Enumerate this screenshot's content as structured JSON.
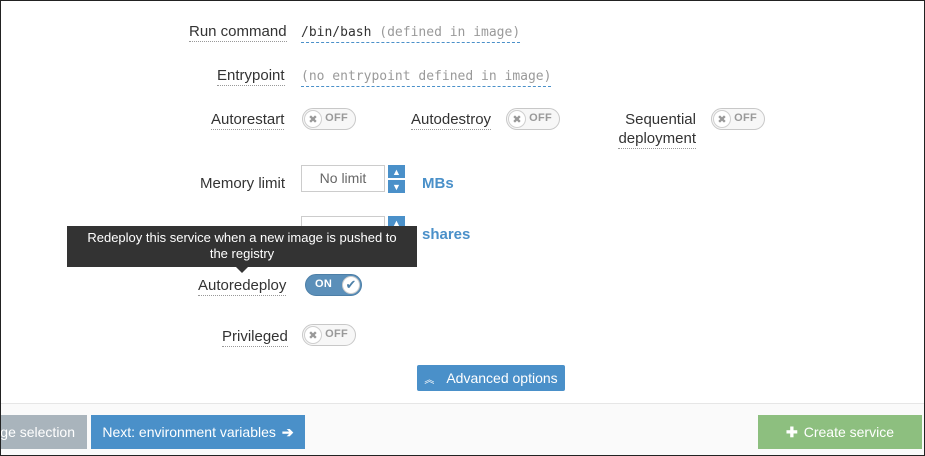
{
  "form": {
    "run_command": {
      "label": "Run command",
      "value": "/bin/bash",
      "hint": "(defined in image)"
    },
    "entrypoint": {
      "label": "Entrypoint",
      "hint": "(no entrypoint defined in image)"
    },
    "autorestart": {
      "label": "Autorestart",
      "state": "OFF"
    },
    "autodestroy": {
      "label": "Autodestroy",
      "state": "OFF"
    },
    "sequential": {
      "label_line1": "Sequential",
      "label_line2": "deployment",
      "state": "OFF"
    },
    "memory_limit": {
      "label": "Memory limit",
      "placeholder": "No limit",
      "unit": "MBs"
    },
    "cpu_shares": {
      "unit": "shares"
    },
    "autoredeploy": {
      "label": "Autoredeploy",
      "state": "ON"
    },
    "privileged": {
      "label": "Privileged",
      "state": "OFF"
    }
  },
  "tooltip": {
    "text": "Redeploy this service when a new image is pushed to the registry"
  },
  "advanced_button": {
    "label": "Advanced options",
    "icon": "double-chevron-up-icon"
  },
  "footer": {
    "back_label": "ge selection",
    "next_label": "Next: environment variables",
    "create_label": "Create service"
  },
  "colors": {
    "accent": "#4a90c9",
    "success": "#8dbf7f",
    "muted": "#9aa7b1",
    "tooltip": "#333333"
  }
}
